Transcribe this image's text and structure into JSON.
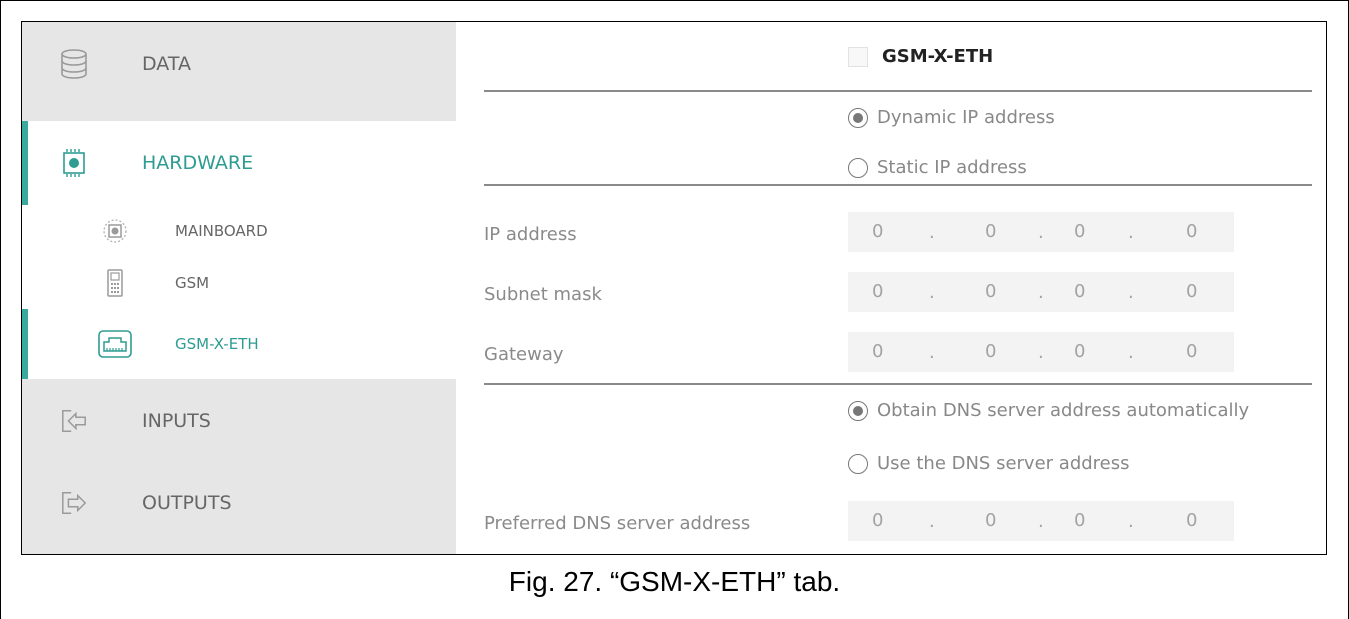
{
  "sidebar": {
    "items": [
      {
        "label": "DATA",
        "icon": "database-icon",
        "active": false
      },
      {
        "label": "HARDWARE",
        "icon": "chip-icon",
        "active": true
      },
      {
        "label": "MAINBOARD",
        "icon": "gear-chip-icon",
        "sub": true
      },
      {
        "label": "GSM",
        "icon": "phone-icon",
        "sub": true
      },
      {
        "label": "GSM-X-ETH",
        "icon": "ethernet-icon",
        "sub": true,
        "active": true
      },
      {
        "label": "INPUTS",
        "icon": "input-arrow-icon"
      },
      {
        "label": "OUTPUTS",
        "icon": "output-arrow-icon"
      }
    ],
    "accent_color": "#3aa99f"
  },
  "panel": {
    "title": "GSM-X-ETH",
    "title_checked": false,
    "ip_mode": {
      "options": [
        "Dynamic IP address",
        "Static IP address"
      ],
      "selected": "Dynamic IP address"
    },
    "fields": [
      {
        "label": "IP address",
        "octets": [
          "0",
          "0",
          "0",
          "0"
        ]
      },
      {
        "label": "Subnet mask",
        "octets": [
          "0",
          "0",
          "0",
          "0"
        ]
      },
      {
        "label": "Gateway",
        "octets": [
          "0",
          "0",
          "0",
          "0"
        ]
      }
    ],
    "dns_mode": {
      "options": [
        "Obtain DNS server address automatically",
        "Use the DNS server address"
      ],
      "selected": "Obtain DNS server address automatically"
    },
    "dns_field": {
      "label": "Preferred DNS server address",
      "octets": [
        "0",
        "0",
        "0",
        "0"
      ]
    },
    "dot": "."
  },
  "caption": "Fig. 27. “GSM-X-ETH” tab."
}
